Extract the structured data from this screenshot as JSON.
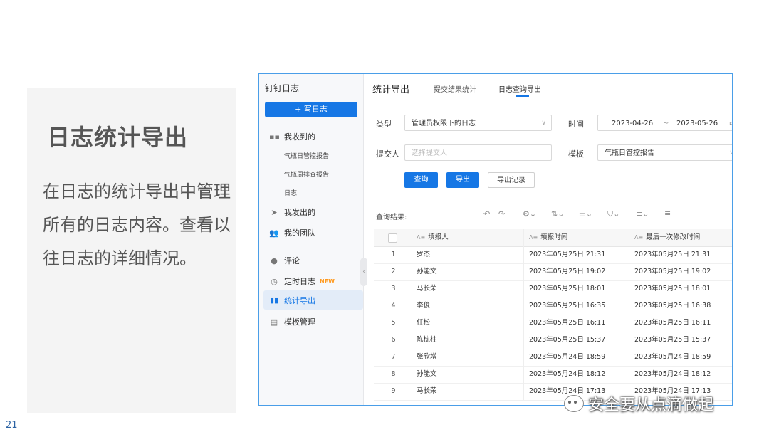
{
  "slide": {
    "title": "日志统计导出",
    "description": "在日志的统计导出中管理所有的日志内容。查看以往日志的详细情况。",
    "page_number": "21",
    "watermark": "安全要从点滴做起"
  },
  "app": {
    "name": "钉钉日志",
    "write_button": "+ 写日志",
    "nav": {
      "received": "我收到的",
      "received_items": [
        "气瓶日管控报告",
        "气瓶周排查报告",
        "日志"
      ],
      "sent": "我发出的",
      "team": "我的团队",
      "comments": "评论",
      "scheduled": "定时日志",
      "scheduled_badge": "NEW",
      "stats_export": "统计导出",
      "templates": "模板管理"
    },
    "tabs": {
      "main": "统计导出",
      "submit_stats": "提交结果统计",
      "log_query_export": "日志查询导出"
    },
    "filters": {
      "type_label": "类型",
      "type_value": "管理员权限下的日志",
      "time_label": "时间",
      "date_from": "2023-04-26",
      "date_sep": "~",
      "date_to": "2023-05-26",
      "submitter_label": "提交人",
      "submitter_placeholder": "选择提交人",
      "template_label": "模板",
      "template_value": "气瓶日管控报告"
    },
    "actions": {
      "query": "查询",
      "export": "导出",
      "export_records": "导出记录"
    },
    "results_label": "查询结果:",
    "table": {
      "headers": {
        "filler": "填报人",
        "fill_time": "填报时间",
        "last_modified": "最后一次修改时间"
      },
      "rows": [
        {
          "idx": "1",
          "filler": "罗杰",
          "time": "2023年05月25日 21:31",
          "modified": "2023年05月25日 21:31"
        },
        {
          "idx": "2",
          "filler": "孙能文",
          "time": "2023年05月25日 19:02",
          "modified": "2023年05月25日 19:02"
        },
        {
          "idx": "3",
          "filler": "马长荣",
          "time": "2023年05月25日 18:01",
          "modified": "2023年05月25日 18:01"
        },
        {
          "idx": "4",
          "filler": "李俊",
          "time": "2023年05月25日 16:35",
          "modified": "2023年05月25日 16:38"
        },
        {
          "idx": "5",
          "filler": "任松",
          "time": "2023年05月25日 16:11",
          "modified": "2023年05月25日 16:11"
        },
        {
          "idx": "6",
          "filler": "陈栋柱",
          "time": "2023年05月25日 15:37",
          "modified": "2023年05月25日 15:37"
        },
        {
          "idx": "7",
          "filler": "张欣增",
          "time": "2023年05月24日 18:59",
          "modified": "2023年05月24日 18:59"
        },
        {
          "idx": "8",
          "filler": "孙能文",
          "time": "2023年05月24日 18:12",
          "modified": "2023年05月24日 18:12"
        },
        {
          "idx": "9",
          "filler": "马长荣",
          "time": "2023年05月24日 17:13",
          "modified": "2023年05月24日 17:13"
        }
      ]
    }
  }
}
